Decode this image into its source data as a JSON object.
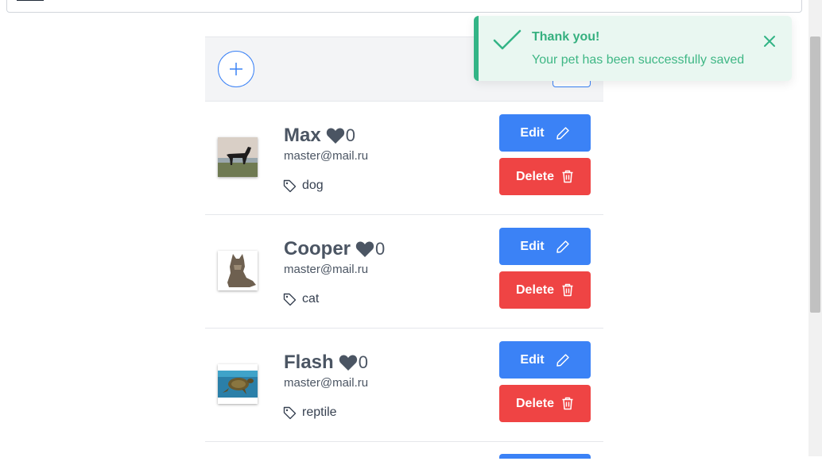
{
  "toast": {
    "title": "Thank you!",
    "message": "Your pet has been successfully saved"
  },
  "actions": {
    "edit_label": "Edit",
    "delete_label": "Delete"
  },
  "pets": [
    {
      "name": "Max",
      "likes": "0",
      "email": "master@mail.ru",
      "tag": "dog",
      "image": "doberman dog"
    },
    {
      "name": "Cooper",
      "likes": "0",
      "email": "master@mail.ru",
      "tag": "cat",
      "image": "maine coon cat"
    },
    {
      "name": "Flash",
      "likes": "0",
      "email": "master@mail.ru",
      "tag": "reptile",
      "image": "sea turtle"
    }
  ],
  "colors": {
    "primary": "#3b82f6",
    "danger": "#ef4444",
    "success": "#33b486",
    "toast_bg": "#e9f7f1"
  }
}
